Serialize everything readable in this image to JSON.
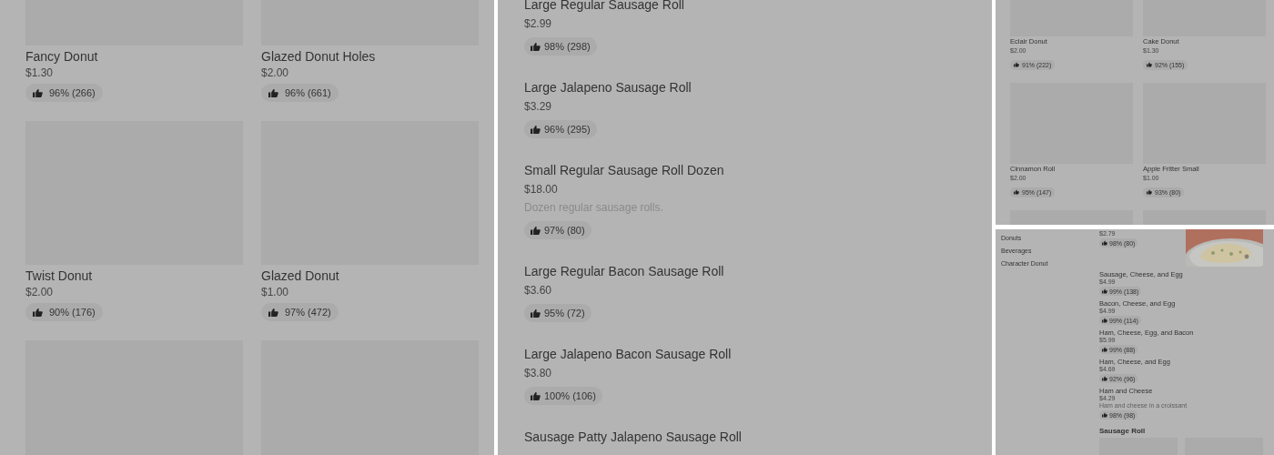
{
  "donut_grid": [
    {
      "name": "Fancy Donut",
      "price": "$1.30",
      "rating": "96% (266)"
    },
    {
      "name": "Glazed Donut Holes",
      "price": "$2.00",
      "rating": "96% (661)"
    },
    {
      "name": "Twist Donut",
      "price": "$2.00",
      "rating": "90% (176)"
    },
    {
      "name": "Glazed Donut",
      "price": "$1.00",
      "rating": "97% (472)"
    },
    {
      "kind": "placeholder"
    },
    {
      "kind": "placeholder"
    }
  ],
  "sausage_roll_list": [
    {
      "name": "Large Regular Sausage Roll",
      "price": "$2.99",
      "rating": "98% (298)"
    },
    {
      "name": "Large Jalapeno Sausage Roll",
      "price": "$3.29",
      "rating": "96% (295)"
    },
    {
      "name": "Small Regular Sausage Roll Dozen",
      "price": "$18.00",
      "description": "Dozen regular sausage rolls.",
      "rating": "97% (80)"
    },
    {
      "name": "Large Regular Bacon Sausage Roll",
      "price": "$3.60",
      "rating": "95% (72)"
    },
    {
      "name": "Large Jalapeno Bacon Sausage Roll",
      "price": "$3.80",
      "rating": "100% (106)"
    },
    {
      "name": "Sausage Patty Jalapeno Sausage Roll"
    }
  ],
  "small_donut_grid": [
    {
      "name": "Eclair Donut",
      "price": "$2.00",
      "rating": "91% (222)"
    },
    {
      "name": "Cake Donut",
      "price": "$1.30",
      "rating": "92% (155)"
    },
    {
      "name": "Cinnamon Roll",
      "price": "$2.00",
      "rating": "95% (147)"
    },
    {
      "name": "Apple Fritter Small",
      "price": "$1.00",
      "rating": "93% (80)"
    },
    {
      "kind": "placeholder"
    },
    {
      "kind": "placeholder"
    }
  ],
  "menu_page": {
    "categories": [
      "Donuts",
      "Beverages",
      "Character Donut"
    ],
    "items": [
      {
        "price": "$2.79",
        "rating": "98% (80)"
      },
      {
        "name": "Sausage, Cheese, and Egg",
        "price": "$4.99",
        "rating": "99% (138)"
      },
      {
        "name": "Bacon, Cheese, and Egg",
        "price": "$4.99",
        "rating": "99% (114)"
      },
      {
        "name": "Ham, Cheese, Egg, and Bacon",
        "price": "$5.99",
        "rating": "99% (88)"
      },
      {
        "name": "Ham, Cheese, and Egg",
        "price": "$4.69",
        "rating": "92% (96)"
      },
      {
        "name": "Ham and Cheese",
        "price": "$4.29",
        "description": "Ham and cheese in a croissant",
        "rating": "98% (98)"
      }
    ],
    "section_heading": "Sausage Roll"
  }
}
